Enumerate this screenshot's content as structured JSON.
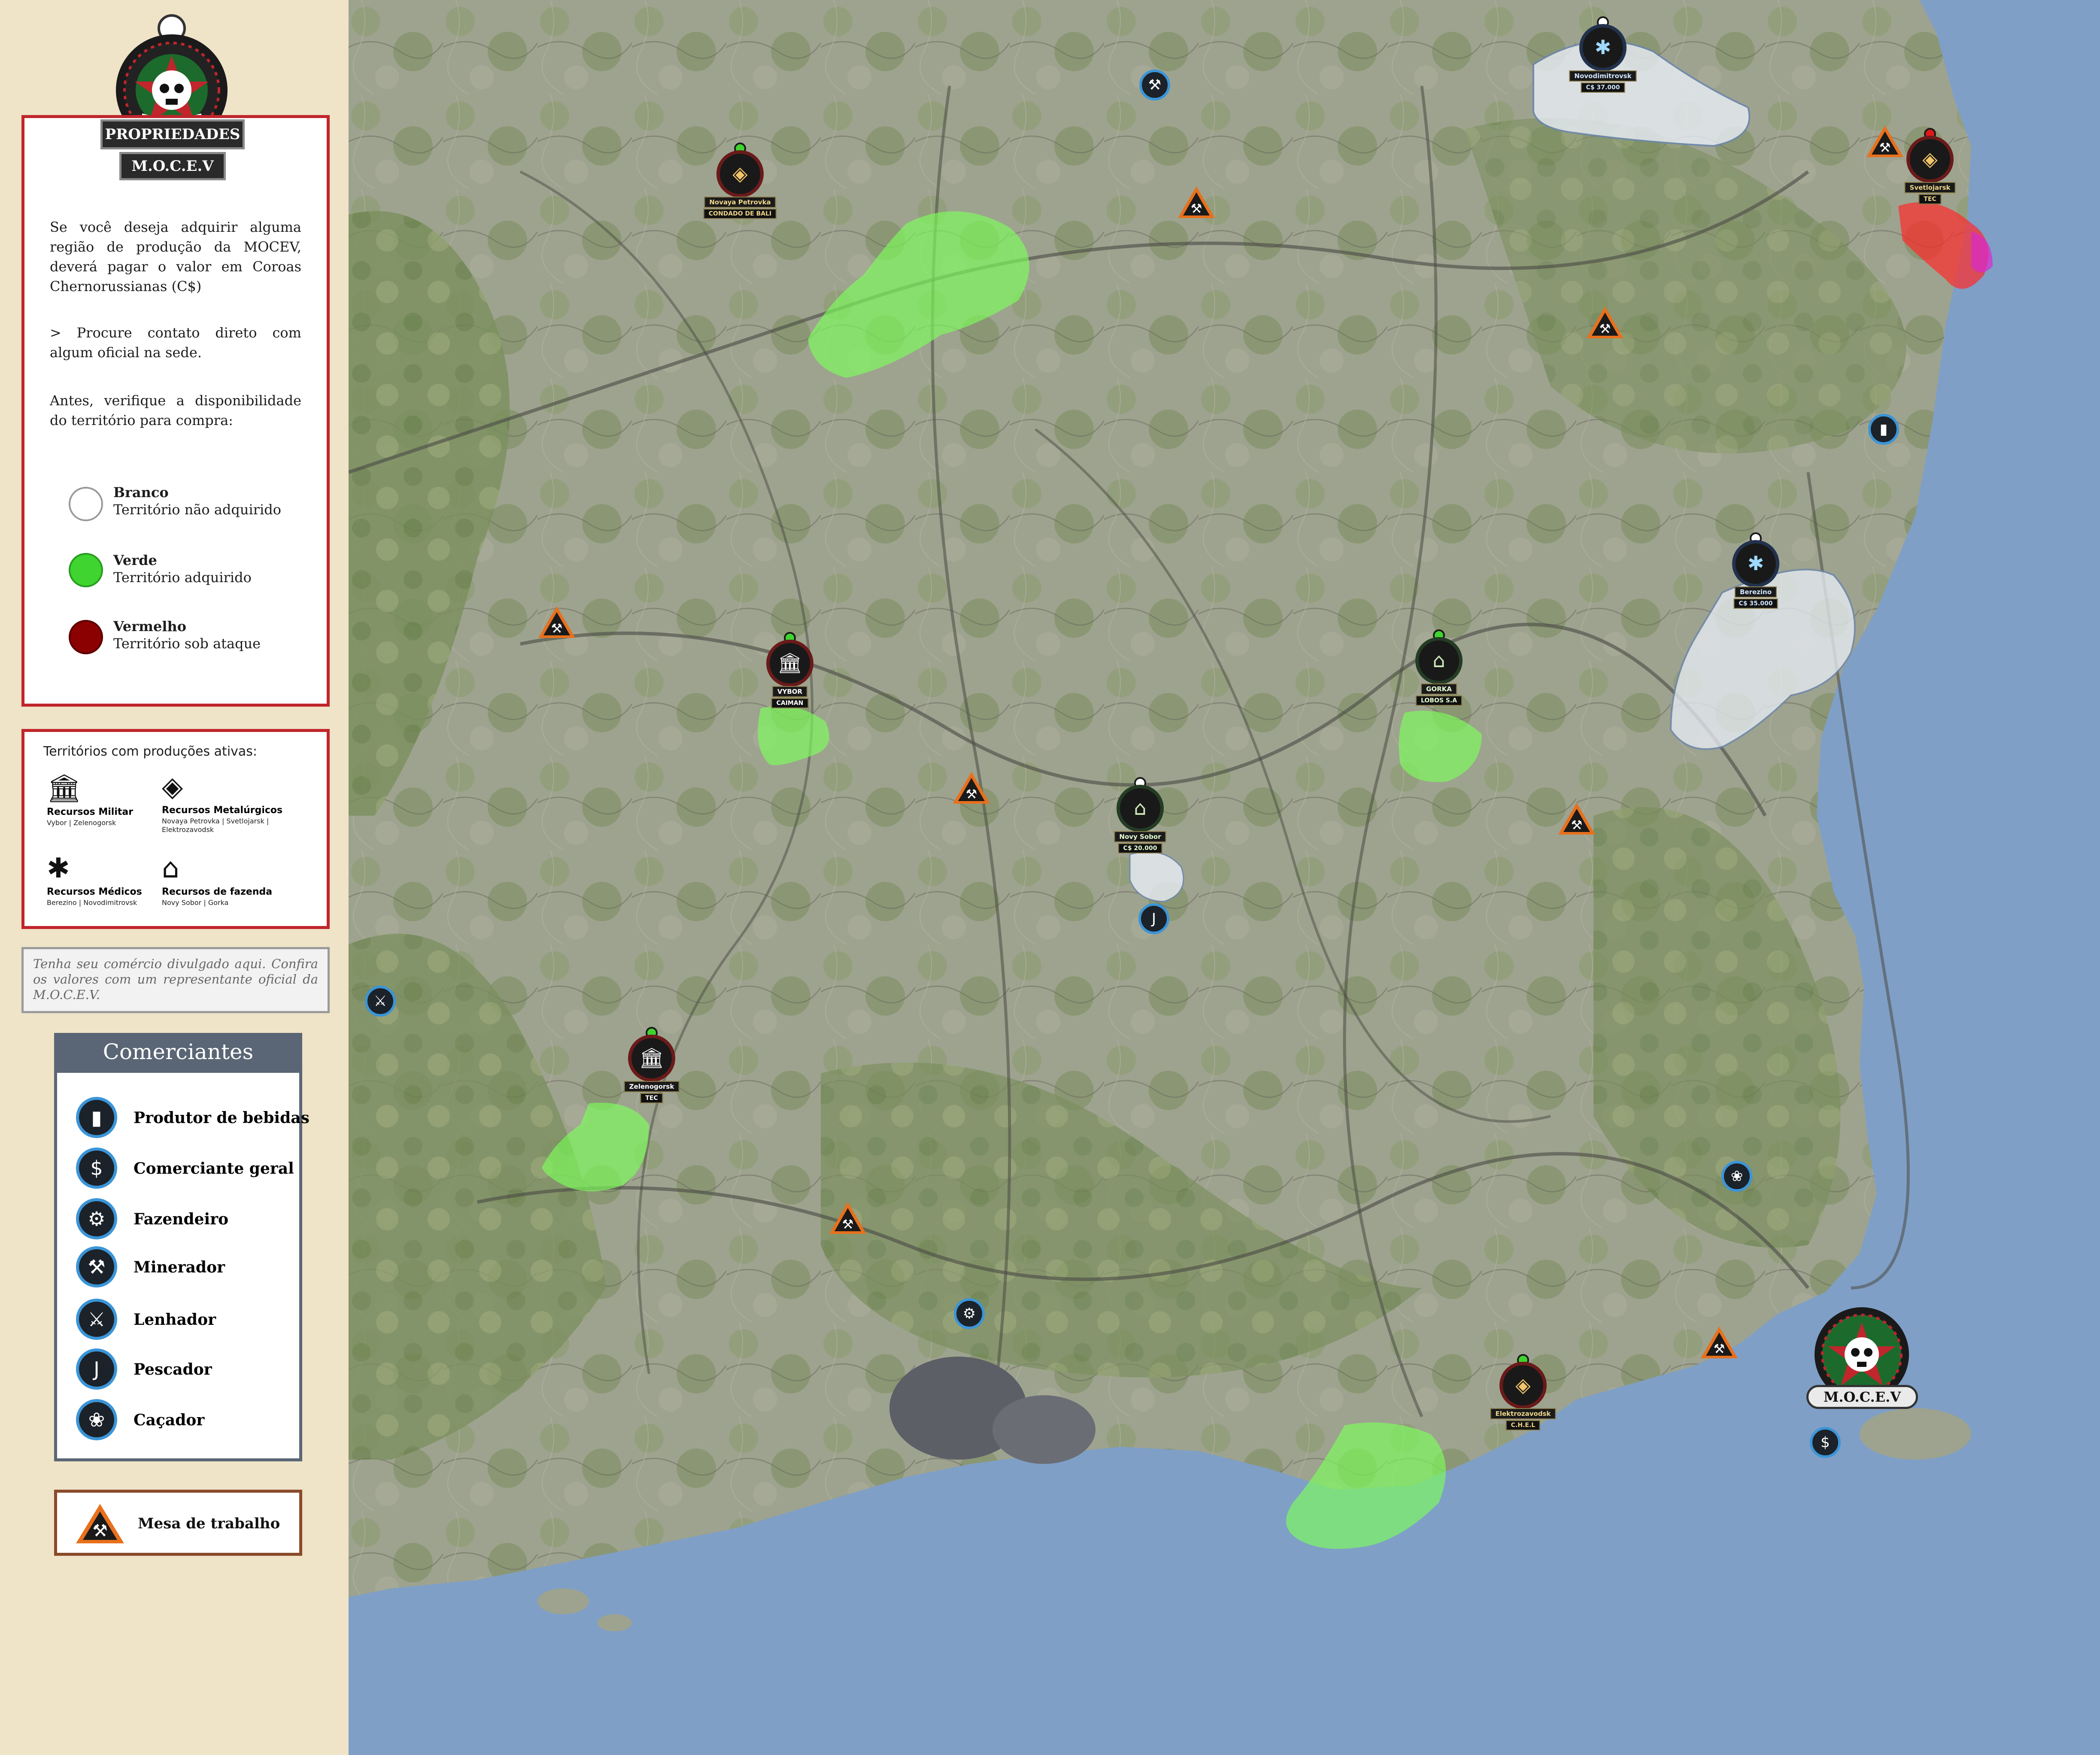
{
  "header": {
    "title": "PROPRIEDADES",
    "subtitle": "M.O.C.E.V"
  },
  "info": {
    "paragraph1": "Se você deseja adquirir alguma região de produção da MOCEV, deverá pagar o valor em Coroas Chernorussianas (C$)",
    "paragraph2": "> Procure contato direto com algum oficial na sede.",
    "paragraph3": "Antes, verifique a disponibilidade do território para compra:"
  },
  "legend": [
    {
      "title": "Branco",
      "subtitle": "Território não adquirido",
      "color": "#ffffff"
    },
    {
      "title": "Verde",
      "subtitle": "Território adquirido",
      "color": "#3fd42f"
    },
    {
      "title": "Vermelho",
      "subtitle": "Território sob ataque",
      "color": "#8b0000"
    }
  ],
  "territories": {
    "title": "Territórios com produções ativas:",
    "items": [
      {
        "name": "Recursos Militar",
        "places": "Vybor | Zelenogorsk",
        "icon": "military-icon"
      },
      {
        "name": "Recursos Metalúrgicos",
        "places": "Novaya Petrovka | Svetlojarsk | Elektrozavodsk",
        "icon": "metal-icon"
      },
      {
        "name": "Recursos Médicos",
        "places": "Berezino | Novodimitrovsk",
        "icon": "medical-icon"
      },
      {
        "name": "Recursos de fazenda",
        "places": "Novy Sobor | Gorka",
        "icon": "farm-icon"
      }
    ]
  },
  "ad": {
    "text": "Tenha seu comércio divulgado aqui. Confira os valores com um representante oficial da M.O.C.E.V."
  },
  "traders": {
    "title": "Comerciantes",
    "items": [
      {
        "label": "Produtor de bebidas",
        "icon": "bottle-icon",
        "glyph": "🍾"
      },
      {
        "label": "Comerciante geral",
        "icon": "money-bag-icon",
        "glyph": "$"
      },
      {
        "label": "Fazendeiro",
        "icon": "tractor-icon",
        "glyph": "⚙"
      },
      {
        "label": "Minerador",
        "icon": "pickaxe-icon",
        "glyph": "⛏"
      },
      {
        "label": "Lenhador",
        "icon": "axe-icon",
        "glyph": "🪓"
      },
      {
        "label": "Pescador",
        "icon": "hook-icon",
        "glyph": "J"
      },
      {
        "label": "Caçador",
        "icon": "paw-icon",
        "glyph": "🐾"
      }
    ]
  },
  "workbench": {
    "label": "Mesa de trabalho",
    "icon": "workbench-icon"
  },
  "map": {
    "headquarters": "M.O.C.E.V",
    "places": [
      {
        "name": "Novaya Petrovka",
        "owner": "CONDADO DE BALI",
        "status": "green",
        "icon": "metal-icon"
      },
      {
        "name": "Novodimitrovsk",
        "owner": "C$ 37.000",
        "status": "white",
        "icon": "medical-icon"
      },
      {
        "name": "Svetlojarsk",
        "owner": "TEC",
        "status": "red",
        "icon": "metal-icon"
      },
      {
        "name": "Berezino",
        "owner": "C$ 35.000",
        "status": "white",
        "icon": "medical-icon"
      },
      {
        "name": "VYBOR",
        "owner": "CAIMAN",
        "status": "green",
        "icon": "military-icon"
      },
      {
        "name": "GORKA",
        "owner": "LOBOS S.A",
        "status": "green",
        "icon": "farm-icon"
      },
      {
        "name": "Novy Sobor",
        "owner": "C$ 20.000",
        "status": "white",
        "icon": "farm-icon"
      },
      {
        "name": "Zelenogorsk",
        "owner": "TEC",
        "status": "green",
        "icon": "military-icon"
      },
      {
        "name": "Elektrozavodsk",
        "owner": "C.H.E.L",
        "status": "green",
        "icon": "metal-icon"
      }
    ]
  },
  "colors": {
    "accent_red": "#c0262c",
    "sidebar_bg": "#efe3c8",
    "sea": "#7f9fc6",
    "land": "#9aa08c",
    "owned_green": "#7dff5a",
    "unowned_white": "#e9eef7",
    "attack_red": "#ff3030"
  }
}
